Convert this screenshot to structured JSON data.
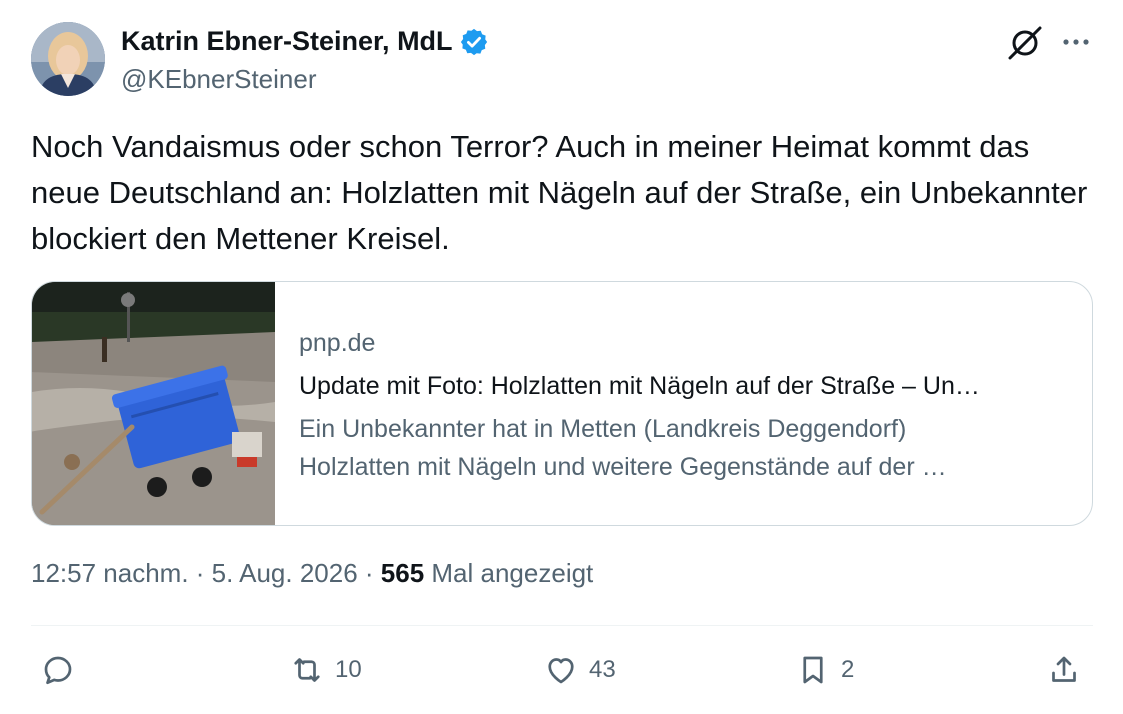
{
  "author": {
    "name": "Katrin Ebner-Steiner, MdL",
    "handle": "@KEbnerSteiner",
    "verified_color": "#1d9bf0"
  },
  "tweet": {
    "text": "Noch Vandaismus oder schon Terror? Auch in meiner Heimat kommt das neue Deutschland an: Holzlatten mit Nägeln auf der Straße, ein Unbekannter blockiert den Mettener Kreisel."
  },
  "card": {
    "domain": "pnp.de",
    "title": "Update mit Foto: Holzlatten mit Nägeln auf der Straße – Un…",
    "description_line1": "Ein Unbekannter hat in Metten (Landkreis Deggendorf)",
    "description_line2": "Holzlatten mit Nägeln und weitere Gegenstände auf der …"
  },
  "meta": {
    "timestamp": "12:57 nachm. · 5. Aug. 2026 · ",
    "views_count": "565",
    "views_label": " Mal angezeigt"
  },
  "actions": {
    "reply_count": "",
    "retweet_count": "10",
    "like_count": "43",
    "bookmark_count": "2"
  },
  "icons": {
    "reply": "reply-icon",
    "retweet": "retweet-icon",
    "like": "heart-icon",
    "bookmark": "bookmark-icon",
    "share": "share-icon",
    "grok": "grok-icon",
    "more": "more-icon"
  }
}
